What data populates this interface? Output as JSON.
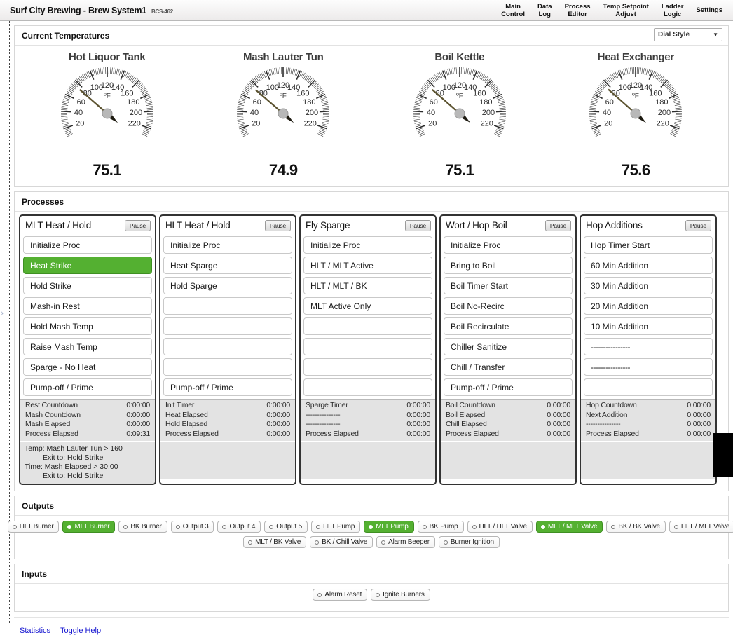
{
  "header": {
    "title": "Surf City Brewing - Brew System1",
    "model": "BCS-462",
    "nav": [
      {
        "label": "Main\nControl"
      },
      {
        "label": "Data\nLog"
      },
      {
        "label": "Process\nEditor"
      },
      {
        "label": "Temp Setpoint\nAdjust"
      },
      {
        "label": "Ladder\nLogic"
      },
      {
        "label": "Settings"
      }
    ]
  },
  "rail": {
    "handle_icon": "›"
  },
  "temperatures": {
    "section_title": "Current Temperatures",
    "style_select": {
      "value": "Dial Style",
      "chevron": "▼"
    },
    "unit": "ºF",
    "scale": {
      "min": 10,
      "max": 230,
      "labels": [
        20,
        40,
        60,
        80,
        100,
        120,
        140,
        160,
        180,
        200,
        220
      ]
    },
    "gauges": [
      {
        "name": "Hot Liquor Tank",
        "value": "75.1",
        "numeric": 75.1
      },
      {
        "name": "Mash Lauter Tun",
        "value": "74.9",
        "numeric": 74.9
      },
      {
        "name": "Boil Kettle",
        "value": "75.1",
        "numeric": 75.1
      },
      {
        "name": "Heat Exchanger",
        "value": "75.6",
        "numeric": 75.6
      }
    ]
  },
  "processes": {
    "section_title": "Processes",
    "pause_label": "Pause",
    "columns": [
      {
        "title": "MLT Heat / Hold",
        "steps": [
          {
            "label": "Initialize Proc",
            "active": false
          },
          {
            "label": "Heat Strike",
            "active": true
          },
          {
            "label": "Hold Strike",
            "active": false
          },
          {
            "label": "Mash-in Rest",
            "active": false
          },
          {
            "label": "Hold Mash Temp",
            "active": false
          },
          {
            "label": "Raise Mash Temp",
            "active": false
          },
          {
            "label": "Sparge - No Heat",
            "active": false
          },
          {
            "label": "Pump-off / Prime",
            "active": false
          }
        ],
        "timers": [
          {
            "label": "Rest Countdown",
            "value": "0:00:00"
          },
          {
            "label": "Mash Countdown",
            "value": "0:00:00"
          },
          {
            "label": "Mash Elapsed",
            "value": "0:00:00"
          },
          {
            "label": "Process Elapsed",
            "value": "0:09:31"
          }
        ],
        "exits": [
          {
            "text": "Temp: Mash Lauter Tun > 160",
            "indent": false
          },
          {
            "text": "Exit to: Hold Strike",
            "indent": true
          },
          {
            "text": "Time: Mash Elapsed > 30:00",
            "indent": false
          },
          {
            "text": "Exit to: Hold Strike",
            "indent": true
          }
        ]
      },
      {
        "title": "HLT Heat / Hold",
        "steps": [
          {
            "label": "Initialize Proc",
            "active": false
          },
          {
            "label": "Heat Sparge",
            "active": false
          },
          {
            "label": "Hold Sparge",
            "active": false
          },
          {
            "label": "",
            "active": false
          },
          {
            "label": "",
            "active": false
          },
          {
            "label": "",
            "active": false
          },
          {
            "label": "",
            "active": false
          },
          {
            "label": "Pump-off / Prime",
            "active": false
          }
        ],
        "timers": [
          {
            "label": "Init Timer",
            "value": "0:00:00"
          },
          {
            "label": "Heat Elapsed",
            "value": "0:00:00"
          },
          {
            "label": "Hold Elapsed",
            "value": "0:00:00"
          },
          {
            "label": "Process Elapsed",
            "value": "0:00:00"
          }
        ],
        "exits": []
      },
      {
        "title": "Fly Sparge",
        "steps": [
          {
            "label": "Initialize Proc",
            "active": false
          },
          {
            "label": "HLT / MLT Active",
            "active": false
          },
          {
            "label": "HLT / MLT / BK",
            "active": false
          },
          {
            "label": "MLT Active Only",
            "active": false
          },
          {
            "label": "",
            "active": false
          },
          {
            "label": "",
            "active": false
          },
          {
            "label": "",
            "active": false
          },
          {
            "label": "",
            "active": false
          }
        ],
        "timers": [
          {
            "label": "Sparge Timer",
            "value": "0:00:00"
          },
          {
            "label": "---------------",
            "value": "0:00:00"
          },
          {
            "label": "---------------",
            "value": "0:00:00"
          },
          {
            "label": "Process Elapsed",
            "value": "0:00:00"
          }
        ],
        "exits": []
      },
      {
        "title": "Wort / Hop Boil",
        "steps": [
          {
            "label": "Initialize Proc",
            "active": false
          },
          {
            "label": "Bring to Boil",
            "active": false
          },
          {
            "label": "Boil Timer Start",
            "active": false
          },
          {
            "label": "Boil No-Recirc",
            "active": false
          },
          {
            "label": "Boil Recirculate",
            "active": false
          },
          {
            "label": "Chiller Sanitize",
            "active": false
          },
          {
            "label": "Chill / Transfer",
            "active": false
          },
          {
            "label": "Pump-off / Prime",
            "active": false
          }
        ],
        "timers": [
          {
            "label": "Boil Countdown",
            "value": "0:00:00"
          },
          {
            "label": "Boil Elapsed",
            "value": "0:00:00"
          },
          {
            "label": "Chill Elapsed",
            "value": "0:00:00"
          },
          {
            "label": "Process Elapsed",
            "value": "0:00:00"
          }
        ],
        "exits": []
      },
      {
        "title": "Hop Additions",
        "steps": [
          {
            "label": "Hop Timer Start",
            "active": false
          },
          {
            "label": "60 Min Addition",
            "active": false
          },
          {
            "label": "30 Min Addition",
            "active": false
          },
          {
            "label": "20 Min Addition",
            "active": false
          },
          {
            "label": "10 Min Addition",
            "active": false
          },
          {
            "label": "----------------",
            "active": false
          },
          {
            "label": "----------------",
            "active": false
          },
          {
            "label": "",
            "active": false
          }
        ],
        "timers": [
          {
            "label": "Hop Countdown",
            "value": "0:00:00"
          },
          {
            "label": "Next Addition",
            "value": "0:00:00"
          },
          {
            "label": "---------------",
            "value": "0:00:00"
          },
          {
            "label": "Process Elapsed",
            "value": "0:00:00"
          }
        ],
        "exits": []
      }
    ]
  },
  "outputs": {
    "section_title": "Outputs",
    "row1": [
      {
        "label": "HLT Burner",
        "on": false
      },
      {
        "label": "MLT Burner",
        "on": true
      },
      {
        "label": "BK Burner",
        "on": false
      },
      {
        "label": "Output 3",
        "on": false
      },
      {
        "label": "Output 4",
        "on": false
      },
      {
        "label": "Output 5",
        "on": false
      },
      {
        "label": "HLT Pump",
        "on": false
      },
      {
        "label": "MLT Pump",
        "on": true
      },
      {
        "label": "BK Pump",
        "on": false
      },
      {
        "label": "HLT / HLT Valve",
        "on": false
      },
      {
        "label": "MLT / MLT Valve",
        "on": true
      },
      {
        "label": "BK / BK Valve",
        "on": false
      },
      {
        "label": "HLT / MLT Valve",
        "on": false
      }
    ],
    "row2": [
      {
        "label": "MLT / BK Valve",
        "on": false
      },
      {
        "label": "BK / Chill Valve",
        "on": false
      },
      {
        "label": "Alarm Beeper",
        "on": false
      },
      {
        "label": "Burner Ignition",
        "on": false
      }
    ]
  },
  "inputs": {
    "section_title": "Inputs",
    "buttons": [
      {
        "label": "Alarm Reset",
        "on": false
      },
      {
        "label": "Ignite Burners",
        "on": false
      }
    ]
  },
  "footer": {
    "links": [
      {
        "label": "Statistics"
      },
      {
        "label": "Toggle Help"
      }
    ]
  }
}
